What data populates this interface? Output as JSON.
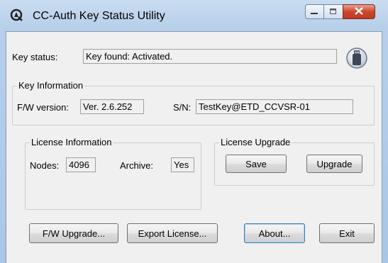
{
  "window": {
    "title": "CC-Auth Key Status Utility"
  },
  "key_status": {
    "label": "Key status:",
    "value": "Key found: Activated."
  },
  "key_info": {
    "group_title": "Key Information",
    "fw_label": "F/W version:",
    "fw_value": "Ver. 2.6.252",
    "sn_label": "S/N:",
    "sn_value": "TestKey@ETD_CCVSR-01"
  },
  "license_info": {
    "group_title": "License Information",
    "nodes_label": "Nodes:",
    "nodes_value": "4096",
    "archive_label": "Archive:",
    "archive_value": "Yes"
  },
  "license_upgrade": {
    "group_title": "License Upgrade",
    "save_label": "Save",
    "upgrade_label": "Upgrade"
  },
  "bottom_buttons": {
    "fw_upgrade": "F/W Upgrade...",
    "export_license": "Export License...",
    "about": "About...",
    "exit": "Exit"
  },
  "icons": {
    "app": "cc-auth-app-icon",
    "key_status": "usb-key-icon",
    "minimize": "minimize-icon",
    "maximize": "maximize-icon",
    "close": "close-icon"
  }
}
